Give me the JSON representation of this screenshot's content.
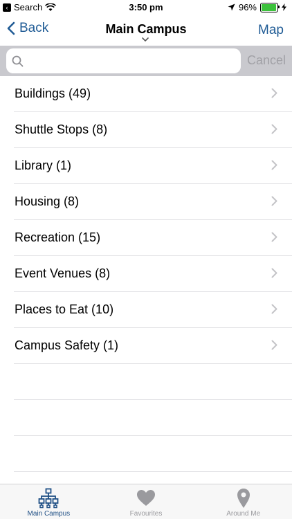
{
  "status_bar": {
    "back_app_label": "Search",
    "time": "3:50 pm",
    "battery_percent": "96%",
    "battery_level": 0.96
  },
  "nav": {
    "back_label": "Back",
    "title": "Main Campus",
    "right_label": "Map"
  },
  "search": {
    "placeholder": "",
    "value": "",
    "cancel_label": "Cancel"
  },
  "list": {
    "items": [
      {
        "label": "Buildings (49)"
      },
      {
        "label": "Shuttle Stops (8)"
      },
      {
        "label": "Library (1)"
      },
      {
        "label": "Housing (8)"
      },
      {
        "label": "Recreation (15)"
      },
      {
        "label": "Event Venues (8)"
      },
      {
        "label": "Places to Eat (10)"
      },
      {
        "label": "Campus Safety (1)"
      }
    ]
  },
  "tab_bar": {
    "tabs": [
      {
        "label": "Main Campus",
        "icon": "hierarchy-icon",
        "active": true
      },
      {
        "label": "Favourites",
        "icon": "heart-icon",
        "active": false
      },
      {
        "label": "Around Me",
        "icon": "location-pin-icon",
        "active": false
      }
    ]
  },
  "colors": {
    "accent": "#1f5b95",
    "search_bar_bg": "#c9c9ce",
    "tab_inactive": "#9a9a9e",
    "battery": "#3cc23c"
  }
}
